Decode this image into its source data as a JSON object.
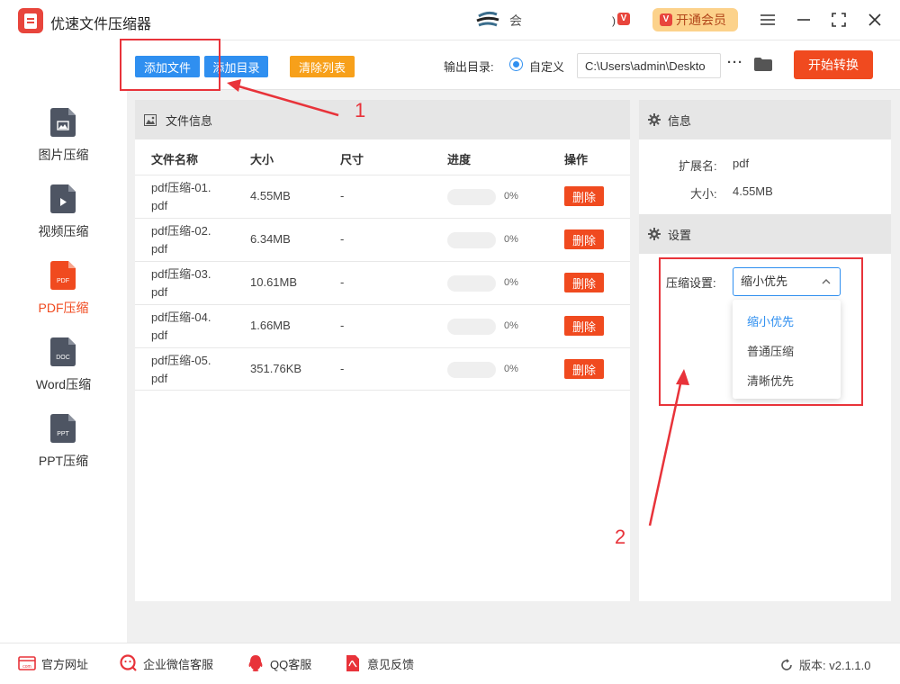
{
  "app": {
    "title": "优速文件压缩器",
    "middle_text": "会",
    "mini_bracket": ")",
    "mini_vip_letter": "V",
    "vip_button_label": "开通会员"
  },
  "toolbar": {
    "add_file": "添加文件",
    "add_dir": "添加目录",
    "clear_list": "清除列表",
    "output_label": "输出目录:",
    "output_option": "自定义",
    "output_path": "C:\\Users\\admin\\Deskto",
    "more": "···",
    "start": "开始转换"
  },
  "sidebar": {
    "items": [
      {
        "label": "图片压缩",
        "icon": "image-file-icon",
        "tag": ""
      },
      {
        "label": "视频压缩",
        "icon": "video-file-icon",
        "tag": ""
      },
      {
        "label": "PDF压缩",
        "icon": "pdf-file-icon",
        "tag": "PDF"
      },
      {
        "label": "Word压缩",
        "icon": "doc-file-icon",
        "tag": "DOC"
      },
      {
        "label": "PPT压缩",
        "icon": "ppt-file-icon",
        "tag": "PPT"
      }
    ],
    "active_index": 2
  },
  "file_panel": {
    "header": "文件信息",
    "columns": [
      "文件名称",
      "大小",
      "尺寸",
      "进度",
      "操作"
    ],
    "rows": [
      {
        "name_line1": "pdf压缩-01.",
        "name_line2": "pdf",
        "size": "4.55MB",
        "dimension": "-",
        "progress": 0,
        "progress_text": "0%",
        "action": "删除"
      },
      {
        "name_line1": "pdf压缩-02.",
        "name_line2": "pdf",
        "size": "6.34MB",
        "dimension": "-",
        "progress": 0,
        "progress_text": "0%",
        "action": "删除"
      },
      {
        "name_line1": "pdf压缩-03.",
        "name_line2": "pdf",
        "size": "10.61MB",
        "dimension": "-",
        "progress": 0,
        "progress_text": "0%",
        "action": "删除"
      },
      {
        "name_line1": "pdf压缩-04.",
        "name_line2": "pdf",
        "size": "1.66MB",
        "dimension": "-",
        "progress": 0,
        "progress_text": "0%",
        "action": "删除"
      },
      {
        "name_line1": "pdf压缩-05.",
        "name_line2": "pdf",
        "size": "351.76KB",
        "dimension": "-",
        "progress": 0,
        "progress_text": "0%",
        "action": "删除"
      }
    ]
  },
  "info_panel": {
    "header": "信息",
    "ext_label": "扩展名:",
    "ext_value": "pdf",
    "size_label": "大小:",
    "size_value": "4.55MB"
  },
  "settings_panel": {
    "header": "设置",
    "compress_label": "压缩设置:",
    "selected": "缩小优先",
    "options": [
      "缩小优先",
      "普通压缩",
      "清晰优先"
    ]
  },
  "annotations": {
    "label_1": "1",
    "label_2": "2",
    "color": "#e8333a"
  },
  "footer": {
    "website": "官方网址",
    "wechat": "企业微信客服",
    "qq": "QQ客服",
    "feedback": "意见反馈",
    "version": "版本: v2.1.1.0"
  },
  "colors": {
    "primary_blue": "#2f8ff0",
    "accent_orange": "#f7a01a",
    "action_red": "#f04a1f",
    "vip_gold": "#fcd28b"
  }
}
